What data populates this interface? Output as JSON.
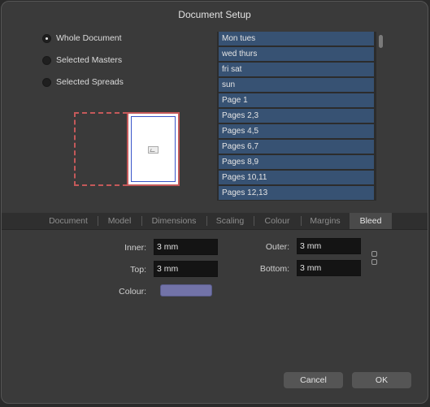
{
  "window": {
    "title": "Document Setup"
  },
  "scope_options": [
    {
      "label": "Whole Document",
      "checked": true
    },
    {
      "label": "Selected Masters",
      "checked": false
    },
    {
      "label": "Selected Spreads",
      "checked": false
    }
  ],
  "page_list": [
    "Mon tues",
    "wed thurs",
    "fri sat",
    "sun",
    "Page 1",
    "Pages 2,3",
    "Pages 4,5",
    "Pages 6,7",
    "Pages 8,9",
    "Pages 10,11",
    "Pages 12,13"
  ],
  "tabs": [
    "Document",
    "Model",
    "Dimensions",
    "Scaling",
    "Colour",
    "Margins",
    "Bleed"
  ],
  "active_tab": "Bleed",
  "bleed": {
    "inner_label": "Inner:",
    "inner_value": "3 mm",
    "outer_label": "Outer:",
    "outer_value": "3 mm",
    "top_label": "Top:",
    "top_value": "3 mm",
    "bottom_label": "Bottom:",
    "bottom_value": "3 mm",
    "colour_label": "Colour:",
    "colour_value": "#7273a8"
  },
  "buttons": {
    "cancel": "Cancel",
    "ok": "OK"
  }
}
